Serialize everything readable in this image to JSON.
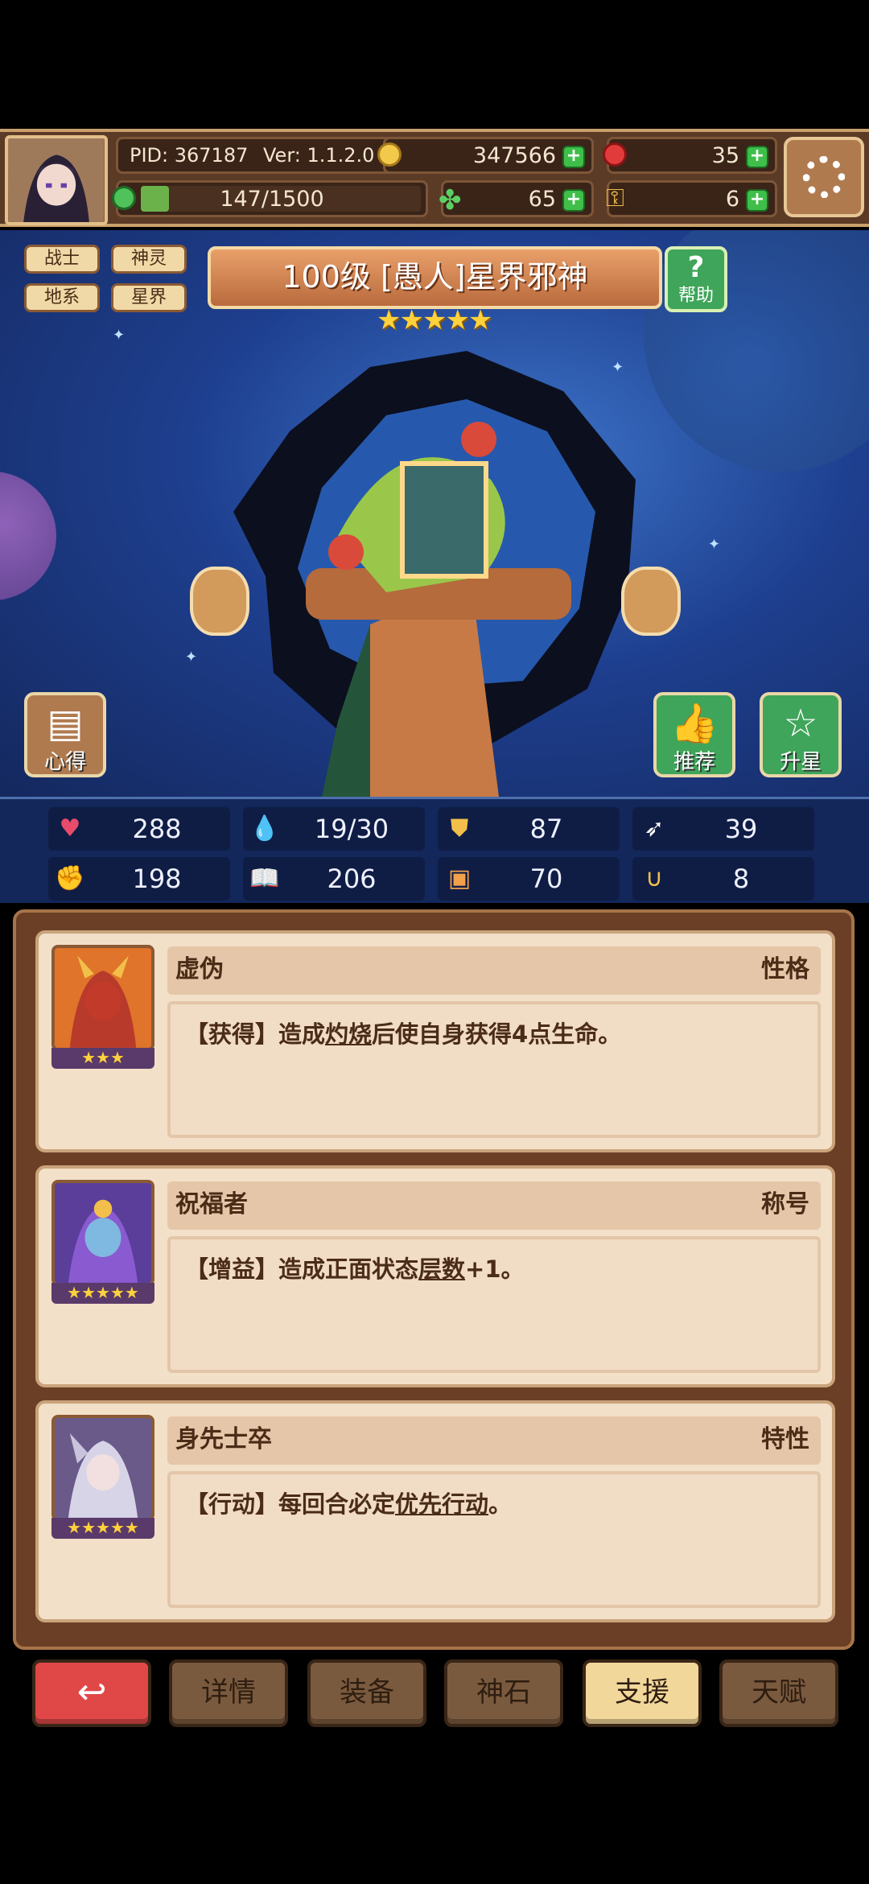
{
  "header": {
    "pid": "PID: 367187",
    "version": "Ver: 1.1.2.0",
    "gold": "347566",
    "red_gems": "35",
    "stamina": "147/1500",
    "clover": "65",
    "keys": "6"
  },
  "tags": [
    "战士",
    "神灵",
    "地系",
    "星界"
  ],
  "hero": {
    "title": "100级 [愚人]星界邪神",
    "stars": "★★★★★",
    "help_label": "帮助",
    "notes_label": "心得",
    "recommend_label": "推荐",
    "starup_label": "升星"
  },
  "stats": [
    {
      "icon": "heart-icon",
      "value": "288",
      "color": "#e84c6a"
    },
    {
      "icon": "water-drop-icon",
      "value": "19/30",
      "color": "#66c6ff"
    },
    {
      "icon": "shield-icon",
      "value": "87",
      "color": "#f2c04a"
    },
    {
      "icon": "wing-icon",
      "value": "39",
      "color": "#ffffff"
    },
    {
      "icon": "fist-icon",
      "value": "198",
      "color": "#e88e7c"
    },
    {
      "icon": "book-icon",
      "value": "206",
      "color": "#7fc4f0"
    },
    {
      "icon": "card-icon",
      "value": "70",
      "color": "#f2a04a"
    },
    {
      "icon": "horseshoe-icon",
      "value": "8",
      "color": "#f2c04a"
    }
  ],
  "support_cards": [
    {
      "name": "虚伪",
      "type": "性格",
      "rank": "★★★",
      "desc_prefix": "【获得】造成",
      "desc_link": "灼烧",
      "desc_suffix": "后使自身获得4点生命。"
    },
    {
      "name": "祝福者",
      "type": "称号",
      "rank": "★★★★★",
      "desc_prefix": "【增益】造成正面状态",
      "desc_link": "层数",
      "desc_suffix": "+1。"
    },
    {
      "name": "身先士卒",
      "type": "特性",
      "rank": "★★★★★",
      "desc_prefix": "【行动】每回合必定",
      "desc_link": "优先行动",
      "desc_suffix": "。"
    }
  ],
  "nav": {
    "back": "↩",
    "details": "详情",
    "equipment": "装备",
    "godstone": "神石",
    "support": "支援",
    "talent": "天赋"
  }
}
